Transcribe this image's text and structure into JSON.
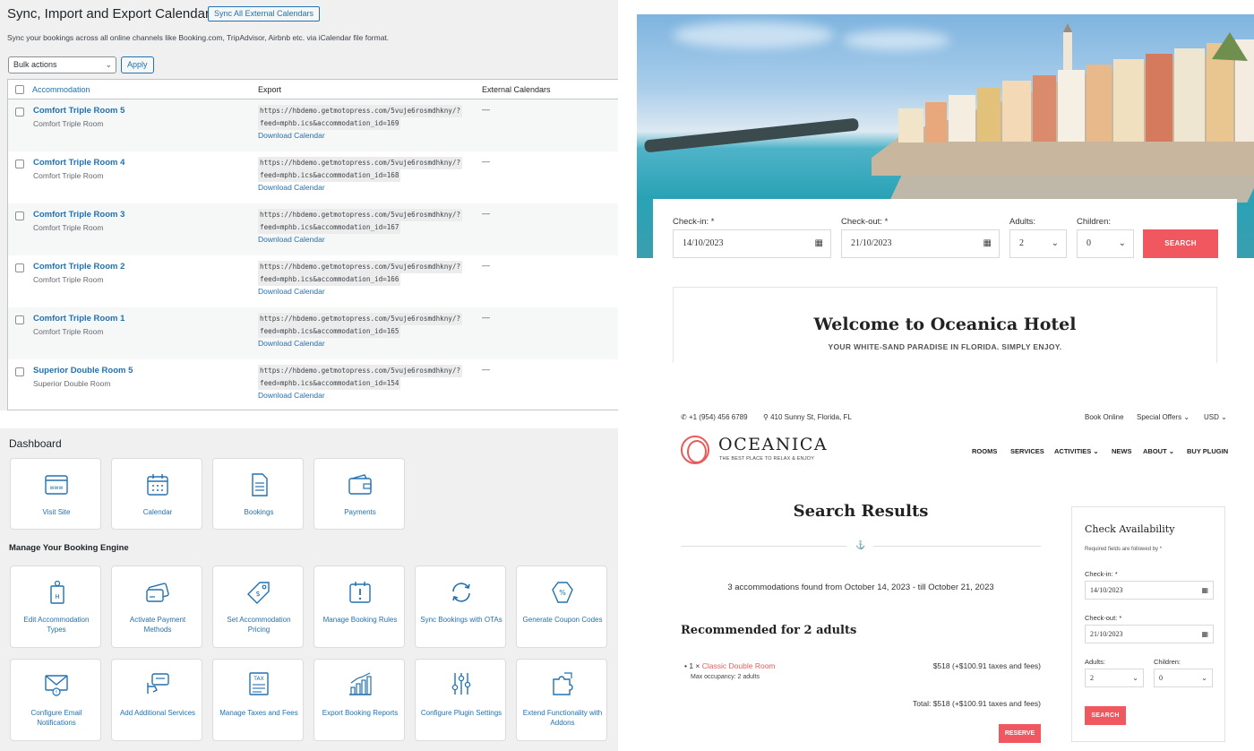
{
  "sync": {
    "title": "Sync, Import and Export Calendars",
    "sync_all_label": "Sync All External Calendars",
    "description": "Sync your bookings across all online channels like Booking.com, TripAdvisor, Airbnb etc. via iCalendar file format.",
    "bulk_actions": "Bulk actions",
    "apply_label": "Apply",
    "columns": [
      "Accommodation",
      "Export",
      "External Calendars"
    ],
    "rows": [
      {
        "title": "Comfort Triple Room 5",
        "type": "Comfort Triple Room",
        "url1": "https://hbdemo.getmotopress.com/5vuje6rosmdhkny/?",
        "url2": "feed=mphb.ics&accommodation_id=169",
        "download": "Download Calendar",
        "external": "—"
      },
      {
        "title": "Comfort Triple Room 4",
        "type": "Comfort Triple Room",
        "url1": "https://hbdemo.getmotopress.com/5vuje6rosmdhkny/?",
        "url2": "feed=mphb.ics&accommodation_id=168",
        "download": "Download Calendar",
        "external": "—"
      },
      {
        "title": "Comfort Triple Room 3",
        "type": "Comfort Triple Room",
        "url1": "https://hbdemo.getmotopress.com/5vuje6rosmdhkny/?",
        "url2": "feed=mphb.ics&accommodation_id=167",
        "download": "Download Calendar",
        "external": "—"
      },
      {
        "title": "Comfort Triple Room 2",
        "type": "Comfort Triple Room",
        "url1": "https://hbdemo.getmotopress.com/5vuje6rosmdhkny/?",
        "url2": "feed=mphb.ics&accommodation_id=166",
        "download": "Download Calendar",
        "external": "—"
      },
      {
        "title": "Comfort Triple Room 1",
        "type": "Comfort Triple Room",
        "url1": "https://hbdemo.getmotopress.com/5vuje6rosmdhkny/?",
        "url2": "feed=mphb.ics&accommodation_id=165",
        "download": "Download Calendar",
        "external": "—"
      },
      {
        "title": "Superior Double Room 5",
        "type": "Superior Double Room",
        "url1": "https://hbdemo.getmotopress.com/5vuje6rosmdhkny/?",
        "url2": "feed=mphb.ics&accommodation_id=154",
        "download": "Download Calendar",
        "external": "—"
      }
    ]
  },
  "hero": {
    "checkin_label": "Check-in: *",
    "checkin_value": "14/10/2023",
    "checkout_label": "Check-out: *",
    "checkout_value": "21/10/2023",
    "adults_label": "Adults:",
    "adults_value": "2",
    "children_label": "Children:",
    "children_value": "0",
    "search_label": "SEARCH"
  },
  "welcome": {
    "title": "Welcome to Oceanica Hotel",
    "subtitle": "YOUR WHITE-SAND PARADISE IN FLORIDA. SIMPLY ENJOY."
  },
  "dashboard": {
    "title": "Dashboard",
    "section_title": "Manage Your Booking Engine",
    "top_tiles": [
      {
        "label": "Visit Site",
        "icon": "browser-icon"
      },
      {
        "label": "Calendar",
        "icon": "calendar-icon"
      },
      {
        "label": "Bookings",
        "icon": "document-icon"
      },
      {
        "label": "Payments",
        "icon": "wallet-icon"
      }
    ],
    "tiles": [
      {
        "label": "Edit Accommodation Types",
        "icon": "bed-tag-icon"
      },
      {
        "label": "Activate Payment Methods",
        "icon": "credit-card-icon"
      },
      {
        "label": "Set Accommodation Pricing",
        "icon": "price-tag-icon"
      },
      {
        "label": "Manage Booking Rules",
        "icon": "rules-calendar-icon"
      },
      {
        "label": "Sync Bookings with OTAs",
        "icon": "sync-icon"
      },
      {
        "label": "Generate Coupon Codes",
        "icon": "coupon-icon"
      },
      {
        "label": "Configure Email Notifications",
        "icon": "envelope-icon"
      },
      {
        "label": "Add Additional Services",
        "icon": "service-hand-icon"
      },
      {
        "label": "Manage Taxes and Fees",
        "icon": "tax-icon"
      },
      {
        "label": "Export Booking Reports",
        "icon": "report-chart-icon"
      },
      {
        "label": "Configure Plugin Settings",
        "icon": "sliders-icon"
      },
      {
        "label": "Extend Functionality with Addons",
        "icon": "puzzle-icon"
      }
    ]
  },
  "oceanica": {
    "phone": "+1 (954) 456 6789",
    "address": "410 Sunny St, Florida, FL",
    "top_links": [
      "Book Online",
      "Special Offers",
      "USD"
    ],
    "brand": "OCEANICA",
    "tagline": "THE BEST PLACE TO RELAX & ENJOY",
    "nav": [
      "ROOMS",
      "SERVICES",
      "ACTIVITIES",
      "NEWS",
      "ABOUT",
      "BUY PLUGIN"
    ],
    "results_title": "Search Results",
    "found_text": "3 accommodations found from October 14, 2023 - till October 21, 2023",
    "recommended": "Recommended for 2 adults",
    "room_qty": "1 ×",
    "room_name": "Classic Double Room",
    "max_occupancy": "Max occupancy: 2 adults",
    "room_price": "$518",
    "room_taxes": "(+$100.91 taxes and fees)",
    "total_label": "Total:",
    "total_price": "$518",
    "total_taxes": "(+$100.91 taxes and fees)",
    "reserve_label": "RESERVE",
    "sidebar": {
      "title": "Check Availability",
      "required_note": "Required fields are followed by *",
      "checkin_label": "Check-in: *",
      "checkin_value": "14/10/2023",
      "checkout_label": "Check-out: *",
      "checkout_value": "21/10/2023",
      "adults_label": "Adults:",
      "adults_value": "2",
      "children_label": "Children:",
      "children_value": "0",
      "search_label": "SEARCH"
    }
  },
  "colors": {
    "wp_link": "#2271b1",
    "wp_bg": "#f0f0f1",
    "oceanica_accent": "#f0575e"
  }
}
